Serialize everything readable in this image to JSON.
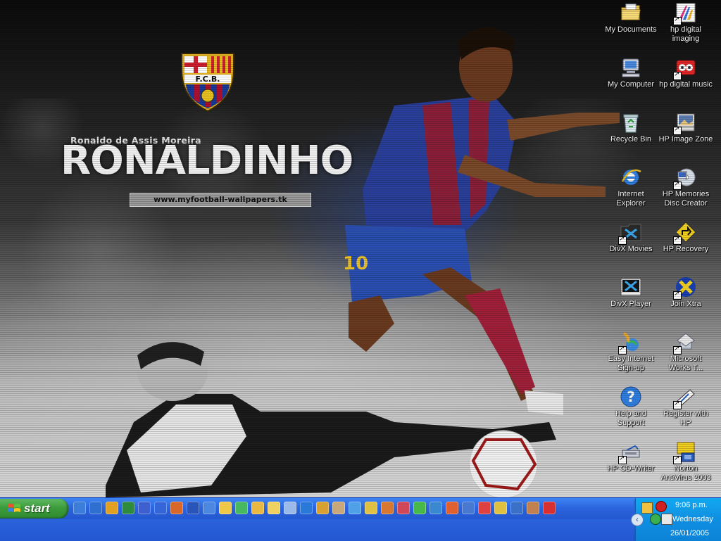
{
  "wallpaper": {
    "subtitle": "Ronaldo de Assis Moreira",
    "title": "RONALDINHO",
    "url": "www.myfootball-wallpapers.tk",
    "badge_text": "F.C.B.",
    "jersey_number": "10"
  },
  "desktop_icons": [
    {
      "label": "My Documents",
      "icon": "folder-icon"
    },
    {
      "label": "hp digital imaging",
      "icon": "hp-imaging-icon"
    },
    {
      "label": "My Computer",
      "icon": "computer-icon"
    },
    {
      "label": "hp digital music",
      "icon": "hp-music-icon"
    },
    {
      "label": "Recycle Bin",
      "icon": "recycle-bin-icon"
    },
    {
      "label": "HP Image Zone",
      "icon": "image-zone-icon"
    },
    {
      "label": "Internet Explorer",
      "icon": "internet-explorer-icon"
    },
    {
      "label": "HP Memories Disc Creator",
      "icon": "disc-creator-icon"
    },
    {
      "label": "DivX Movies",
      "icon": "divx-movies-icon"
    },
    {
      "label": "HP Recovery",
      "icon": "hp-recovery-icon"
    },
    {
      "label": "DivX Player",
      "icon": "divx-player-icon"
    },
    {
      "label": "Join Xtra",
      "icon": "xtra-icon"
    },
    {
      "label": "Easy Internet Sign-up",
      "icon": "signup-icon"
    },
    {
      "label": "Microsoft Works T...",
      "icon": "works-icon"
    },
    {
      "label": "Help and Support",
      "icon": "help-icon"
    },
    {
      "label": "Register with HP",
      "icon": "register-icon"
    },
    {
      "label": "HP CD-Writer",
      "icon": "cd-writer-icon"
    },
    {
      "label": "Norton AntiVirus 2003",
      "icon": "norton-icon"
    }
  ],
  "taskbar": {
    "start_label": "start",
    "quick_launch": [
      {
        "icon": "ie-quicklaunch-icon",
        "color": "#3b7dd8"
      },
      {
        "icon": "ie-quicklaunch-icon",
        "color": "#2f6fd0"
      },
      {
        "icon": "windows-icon",
        "color": "#e0a020"
      },
      {
        "icon": "excel-icon",
        "color": "#2e8b3e"
      },
      {
        "icon": "app-icon",
        "color": "#3d5fcf"
      },
      {
        "icon": "app-icon",
        "color": "#3466d8"
      },
      {
        "icon": "powerpoint-icon",
        "color": "#d8682a"
      },
      {
        "icon": "word-icon",
        "color": "#2a55b8"
      },
      {
        "icon": "app-icon",
        "color": "#4c88e0"
      },
      {
        "icon": "folder-icon",
        "color": "#f0c848"
      },
      {
        "icon": "app-icon",
        "color": "#48b860"
      },
      {
        "icon": "folder-icon",
        "color": "#e8b840"
      },
      {
        "icon": "app-icon",
        "color": "#f0d060"
      },
      {
        "icon": "notepad-icon",
        "color": "#9ab8e8"
      },
      {
        "icon": "media-player-icon",
        "color": "#2a78d8"
      },
      {
        "icon": "app-icon",
        "color": "#d8a030"
      },
      {
        "icon": "app-icon",
        "color": "#c8a878"
      },
      {
        "icon": "search-icon",
        "color": "#50a0e8"
      },
      {
        "icon": "app-icon",
        "color": "#e0c040"
      },
      {
        "icon": "app-icon",
        "color": "#d87830"
      },
      {
        "icon": "app-icon",
        "color": "#d04858"
      },
      {
        "icon": "app-icon",
        "color": "#48b848"
      },
      {
        "icon": "app-icon",
        "color": "#3a88d0"
      },
      {
        "icon": "app-icon",
        "color": "#e06030"
      },
      {
        "icon": "app-icon",
        "color": "#4878d0"
      },
      {
        "icon": "app-icon",
        "color": "#e04040"
      },
      {
        "icon": "app-icon",
        "color": "#e0c040"
      },
      {
        "icon": "app-icon",
        "color": "#3a70c8"
      },
      {
        "icon": "app-icon",
        "color": "#c08050"
      },
      {
        "icon": "app-icon",
        "color": "#d83030"
      }
    ],
    "clock": {
      "time": "9:06 p.m.",
      "day": "Wednesday",
      "date": "26/01/2005"
    }
  }
}
